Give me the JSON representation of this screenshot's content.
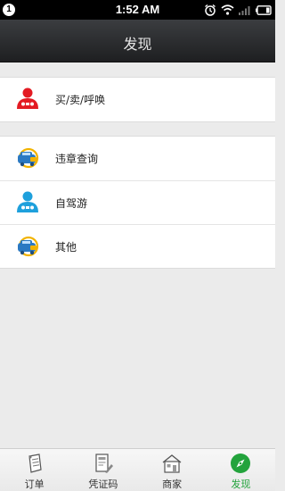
{
  "status_bar": {
    "notification_badge": "1",
    "time": "1:52 AM",
    "icons": [
      "alarm-icon",
      "wifi-icon",
      "signal-icon",
      "battery-icon"
    ]
  },
  "header": {
    "title": "发现"
  },
  "sections": [
    {
      "items": [
        {
          "label": "买/卖/呼唤",
          "icon": "person-red-icon"
        }
      ]
    },
    {
      "items": [
        {
          "label": "违章查询",
          "icon": "car-camera-icon"
        },
        {
          "label": "自驾游",
          "icon": "person-blue-icon"
        },
        {
          "label": "其他",
          "icon": "car-camera-icon"
        }
      ]
    }
  ],
  "tabbar": {
    "tabs": [
      {
        "label": "订单",
        "icon": "order-clipboard-icon"
      },
      {
        "label": "凭证码",
        "icon": "voucher-code-icon"
      },
      {
        "label": "商家",
        "icon": "merchant-house-icon"
      },
      {
        "label": "发现",
        "icon": "compass-icon",
        "active": true
      }
    ]
  },
  "colors": {
    "active_tab": "#23a33c",
    "header_bg": "#2b2c2e"
  }
}
